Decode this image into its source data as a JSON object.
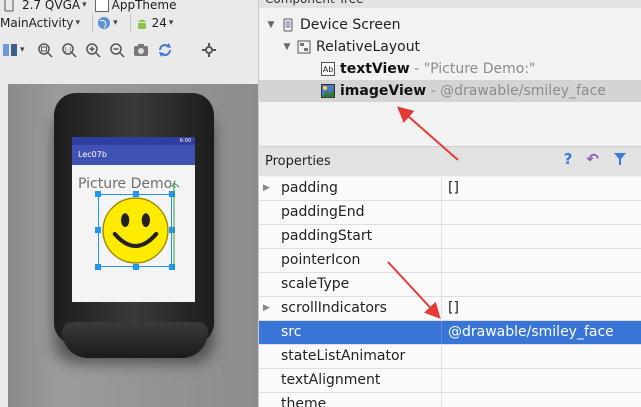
{
  "toolbar": {
    "version": "2.7",
    "device": "QVGA",
    "theme": "AppTheme",
    "activity": "MainActivity",
    "api_level": "24"
  },
  "phone": {
    "status_time": "6:00",
    "app_title": "Lec07b",
    "text_view": "Picture Demo:"
  },
  "component_tree": {
    "header": "Component Tree",
    "items": [
      {
        "label": "Device Screen",
        "detail": ""
      },
      {
        "label": "RelativeLayout",
        "detail": ""
      },
      {
        "label": "textView",
        "detail": "- \"Picture Demo:\""
      },
      {
        "label": "imageView",
        "detail": "- @drawable/smiley_face"
      }
    ]
  },
  "properties": {
    "header": "Properties",
    "rows": [
      {
        "name": "padding",
        "value": "[]",
        "expandable": true
      },
      {
        "name": "paddingEnd",
        "value": ""
      },
      {
        "name": "paddingStart",
        "value": ""
      },
      {
        "name": "pointerIcon",
        "value": ""
      },
      {
        "name": "scaleType",
        "value": ""
      },
      {
        "name": "scrollIndicators",
        "value": "[]",
        "expandable": true
      },
      {
        "name": "src",
        "value": "@drawable/smiley_face",
        "selected": true
      },
      {
        "name": "stateListAnimator",
        "value": ""
      },
      {
        "name": "textAlignment",
        "value": ""
      },
      {
        "name": "theme",
        "value": ""
      }
    ]
  },
  "colors": {
    "selection": "#3875d7",
    "annotation_arrow": "#e53935",
    "app_bar": "#3f51b5",
    "smiley": "#ffeb00"
  }
}
